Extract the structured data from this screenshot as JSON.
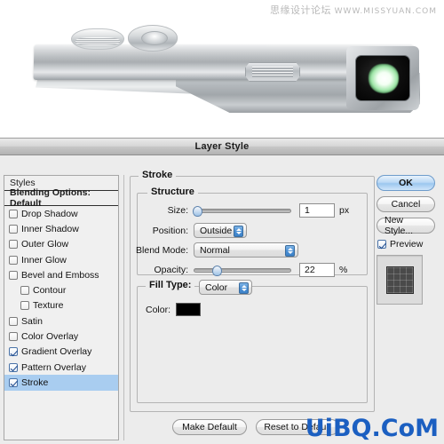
{
  "watermarks": {
    "top_cn": "思缘设计论坛",
    "top_url": "WWW.MISSYUAN.COM",
    "bottom": "UiBQ.CoM",
    "bottom_color": "#1b5fc1"
  },
  "photo": {
    "subject": "silver-compact-camera",
    "lens": "camera-lens",
    "viewfinder": "viewfinder-window",
    "dial_left": "mode-dial",
    "dial_right": "shutter-button"
  },
  "dialog": {
    "title": "Layer Style",
    "styles_panel": {
      "header": "Styles",
      "blending_options": "Blending Options: Default",
      "items": [
        {
          "label": "Drop Shadow",
          "checked": false,
          "indent": false,
          "selected": false
        },
        {
          "label": "Inner Shadow",
          "checked": false,
          "indent": false,
          "selected": false
        },
        {
          "label": "Outer Glow",
          "checked": false,
          "indent": false,
          "selected": false
        },
        {
          "label": "Inner Glow",
          "checked": false,
          "indent": false,
          "selected": false
        },
        {
          "label": "Bevel and Emboss",
          "checked": false,
          "indent": false,
          "selected": false
        },
        {
          "label": "Contour",
          "checked": false,
          "indent": true,
          "selected": false
        },
        {
          "label": "Texture",
          "checked": false,
          "indent": true,
          "selected": false
        },
        {
          "label": "Satin",
          "checked": false,
          "indent": false,
          "selected": false
        },
        {
          "label": "Color Overlay",
          "checked": false,
          "indent": false,
          "selected": false
        },
        {
          "label": "Gradient Overlay",
          "checked": true,
          "indent": false,
          "selected": false
        },
        {
          "label": "Pattern Overlay",
          "checked": true,
          "indent": false,
          "selected": false
        },
        {
          "label": "Stroke",
          "checked": true,
          "indent": false,
          "selected": true
        }
      ]
    },
    "stroke": {
      "group_label": "Stroke",
      "structure": {
        "group_label": "Structure",
        "size_label": "Size:",
        "size_value": "1",
        "size_unit": "px",
        "size_percent": 2,
        "position_label": "Position:",
        "position_value": "Outside",
        "blend_mode_label": "Blend Mode:",
        "blend_mode_value": "Normal",
        "opacity_label": "Opacity:",
        "opacity_value": "22",
        "opacity_unit": "%",
        "opacity_percent": 22
      },
      "fill": {
        "group_label": "Fill Type:",
        "fill_type_value": "Color",
        "color_label": "Color:",
        "color_value": "#000000"
      },
      "make_default": "Make Default",
      "reset_to_default": "Reset to Default"
    },
    "buttons": {
      "ok": "OK",
      "cancel": "Cancel",
      "new_style": "New Style...",
      "preview_label": "Preview",
      "preview_checked": true
    }
  }
}
